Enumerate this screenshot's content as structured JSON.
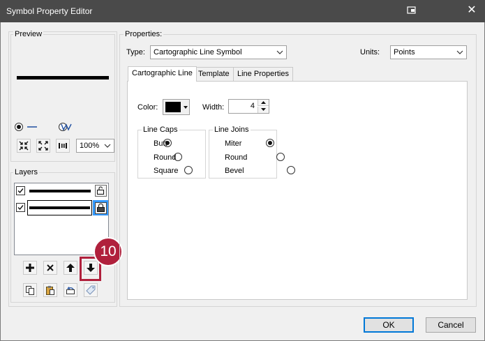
{
  "window": {
    "title": "Symbol Property Editor",
    "close_glyph": "✕"
  },
  "preview": {
    "legend": "Preview",
    "zoom_value": "100%"
  },
  "layers": {
    "legend": "Layers"
  },
  "callout": {
    "number": "10",
    "color": "#b0203c"
  },
  "properties": {
    "legend": "Properties:",
    "type_label": "Type:",
    "type_value": "Cartographic Line Symbol",
    "units_label": "Units:",
    "units_value": "Points",
    "tabs": [
      {
        "label": "Cartographic Line",
        "active": true
      },
      {
        "label": "Template",
        "active": false
      },
      {
        "label": "Line Properties",
        "active": false
      }
    ],
    "color_label": "Color:",
    "width_label": "Width:",
    "width_value": "4",
    "line_caps": {
      "legend": "Line Caps",
      "options": [
        "Butt",
        "Round",
        "Square"
      ],
      "selected": "Butt"
    },
    "line_joins": {
      "legend": "Line Joins",
      "options": [
        "Miter",
        "Round",
        "Bevel"
      ],
      "selected": "Miter"
    }
  },
  "footer": {
    "ok_label": "OK",
    "cancel_label": "Cancel"
  },
  "colors": {
    "accent": "#0078d7",
    "titlebar": "#4a4a4a",
    "callout": "#b0203c"
  }
}
